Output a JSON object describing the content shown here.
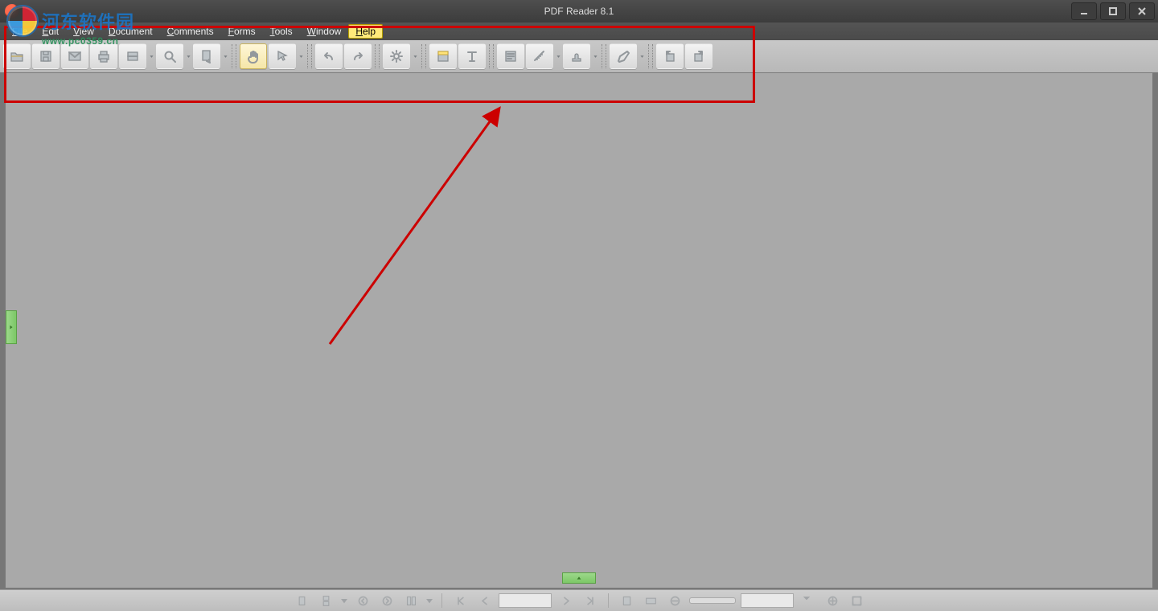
{
  "title": "PDF Reader 8.1",
  "watermark": {
    "line1": "河东软件园",
    "line2": "www.pc0359.cn"
  },
  "menus": [
    {
      "hot": "F",
      "rest": "ile"
    },
    {
      "hot": "E",
      "rest": "dit"
    },
    {
      "hot": "V",
      "rest": "iew"
    },
    {
      "hot": "D",
      "rest": "ocument"
    },
    {
      "hot": "C",
      "rest": "omments"
    },
    {
      "hot": "F",
      "rest": "orms"
    },
    {
      "hot": "T",
      "rest": "ools"
    },
    {
      "hot": "W",
      "rest": "indow"
    },
    {
      "hot": "H",
      "rest": "elp",
      "highlight": true
    }
  ],
  "toolbar": {
    "groups": [
      {
        "items": [
          {
            "name": "open-file-icon",
            "icon": "folder"
          },
          {
            "name": "save-icon",
            "icon": "save"
          },
          {
            "name": "email-icon",
            "icon": "mail"
          },
          {
            "name": "print-icon",
            "icon": "print"
          },
          {
            "name": "scan-icon",
            "icon": "scan",
            "drop": true
          },
          {
            "name": "zoom-tool-icon",
            "icon": "magnify",
            "drop": true
          },
          {
            "name": "document-send-icon",
            "icon": "docsend",
            "drop": true
          }
        ]
      },
      {
        "items": [
          {
            "name": "hand-tool-icon",
            "icon": "hand",
            "active": true
          },
          {
            "name": "select-tool-icon",
            "icon": "pointer",
            "drop": true
          }
        ]
      },
      {
        "items": [
          {
            "name": "undo-icon",
            "icon": "undo"
          },
          {
            "name": "redo-icon",
            "icon": "redo"
          }
        ]
      },
      {
        "items": [
          {
            "name": "settings-icon",
            "icon": "gear",
            "drop": true
          }
        ]
      },
      {
        "items": [
          {
            "name": "highlight-icon",
            "icon": "highlight"
          },
          {
            "name": "text-tool-icon",
            "icon": "text"
          }
        ]
      },
      {
        "items": [
          {
            "name": "note-icon",
            "icon": "note"
          },
          {
            "name": "measure-icon",
            "icon": "measure",
            "drop": true
          },
          {
            "name": "stamp-icon",
            "icon": "stamp",
            "drop": true
          }
        ]
      },
      {
        "items": [
          {
            "name": "draw-line-icon",
            "icon": "pencil",
            "drop": true
          }
        ]
      },
      {
        "items": [
          {
            "name": "rotate-left-icon",
            "icon": "rotleft"
          },
          {
            "name": "rotate-right-icon",
            "icon": "rotright"
          }
        ]
      }
    ]
  },
  "statusbar": {
    "items": [
      {
        "name": "single-page-icon",
        "icon": "singlepage",
        "type": "button"
      },
      {
        "name": "continuous-page-icon",
        "icon": "contpage",
        "type": "button",
        "drop": true
      },
      {
        "name": "nav-prev-view-icon",
        "icon": "circleleft",
        "type": "button"
      },
      {
        "name": "nav-next-view-icon",
        "icon": "circleright",
        "type": "button"
      },
      {
        "name": "page-layout-icon",
        "icon": "layout",
        "type": "button",
        "drop": true
      },
      {
        "name": "sep",
        "type": "sep"
      },
      {
        "name": "first-page-icon",
        "icon": "first",
        "type": "button"
      },
      {
        "name": "prev-page-icon",
        "icon": "prev",
        "type": "button"
      },
      {
        "name": "page-number-field",
        "type": "field"
      },
      {
        "name": "next-page-icon",
        "icon": "next",
        "type": "button"
      },
      {
        "name": "last-page-icon",
        "icon": "last",
        "type": "button"
      },
      {
        "name": "sep",
        "type": "sep"
      },
      {
        "name": "fit-page-icon",
        "icon": "fitpage",
        "type": "button"
      },
      {
        "name": "fit-width-icon",
        "icon": "fitwidth",
        "type": "button"
      },
      {
        "name": "zoom-out-icon",
        "icon": "minus",
        "type": "button"
      },
      {
        "name": "zoom-slider",
        "type": "slider"
      },
      {
        "name": "zoom-value-field",
        "type": "field"
      },
      {
        "name": "zoom-dropdown-icon",
        "icon": "dd",
        "type": "button"
      },
      {
        "name": "zoom-in-icon",
        "icon": "plus",
        "type": "button"
      },
      {
        "name": "fullscreen-icon",
        "icon": "fullscreen",
        "type": "button"
      }
    ]
  }
}
